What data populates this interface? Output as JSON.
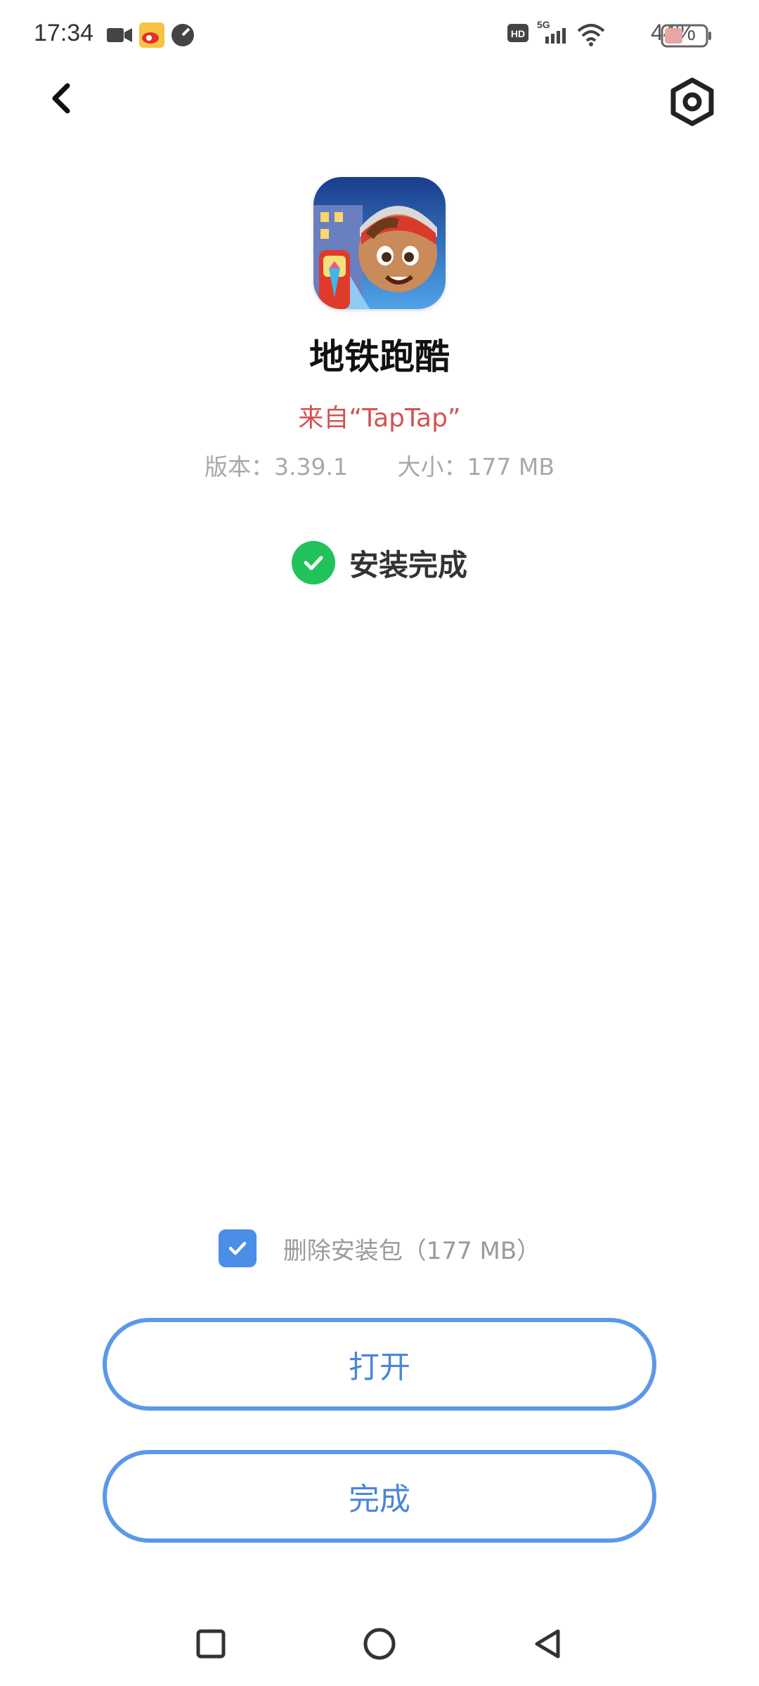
{
  "status_bar": {
    "time": "17:34",
    "battery_percent": "44%",
    "network": "5G",
    "hd_label": "HD",
    "battery_level": 0.44
  },
  "header": {
    "back_icon": "back-arrow-icon",
    "settings_icon": "gear-icon"
  },
  "app": {
    "name": "地铁跑酷",
    "source": "来自“TapTap”",
    "version": "版本：3.39.1",
    "size": "大小：177 MB"
  },
  "install": {
    "status": "安装完成",
    "status_color": "#21c25a"
  },
  "options": {
    "delete_package_label": "删除安装包（177 MB）",
    "delete_package_checked": true
  },
  "buttons": {
    "open_label": "打开",
    "done_label": "完成",
    "accent": "#5b98ea"
  },
  "nav": {
    "recent_icon": "square-icon",
    "home_icon": "circle-icon",
    "back_icon": "triangle-back-icon"
  }
}
